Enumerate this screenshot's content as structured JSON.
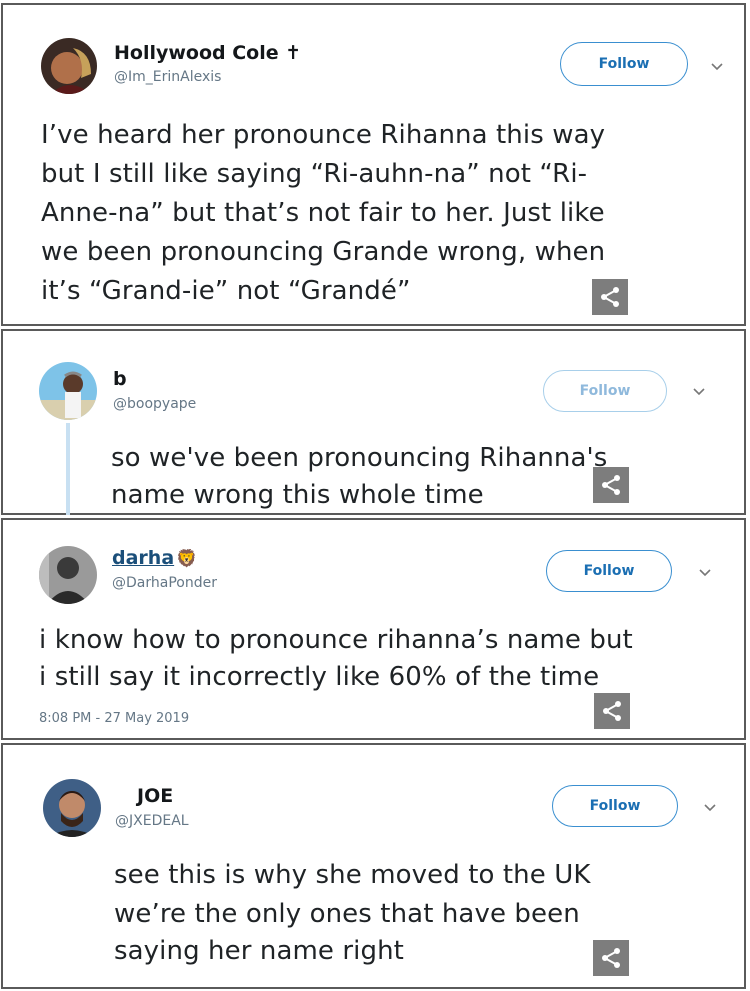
{
  "tweets": [
    {
      "name": "Hollywood Cole ✝",
      "handle": "@Im_ErinAlexis",
      "follow_label": "Follow",
      "lines": [
        "I’ve heard her pronounce Rihanna this way",
        "but I still like saying “Ri-auhn-na” not “Ri-",
        "Anne-na” but that’s not fair to her. Just like",
        "we been pronouncing Grande wrong, when",
        "it’s “Grand-ie” not “Grandé”"
      ]
    },
    {
      "name": "b",
      "handle": "@boopyape",
      "follow_label": "Follow",
      "lines": [
        "so we've been pronouncing Rihanna's",
        "name wrong this whole time"
      ]
    },
    {
      "name": "darha",
      "name_emoji": "🦁",
      "handle": "@DarhaPonder",
      "follow_label": "Follow",
      "lines": [
        "i know how to pronounce rihanna’s name but",
        "i still say it incorrectly like 60% of the time"
      ],
      "timestamp": "8:08 PM - 27 May 2019"
    },
    {
      "name": "JOE",
      "handle": "@JXEDEAL",
      "follow_label": "Follow",
      "lines": [
        "see this is why she moved to the UK",
        "we’re the only ones that have been",
        "saying her name right"
      ]
    }
  ],
  "icons": {
    "share": "share-icon",
    "chevron": "chevron-down-icon"
  },
  "colors": {
    "follow_blue": "#1b6fb3",
    "share_gray": "#7d7d7d",
    "thread_line": "#c8e0f2"
  }
}
